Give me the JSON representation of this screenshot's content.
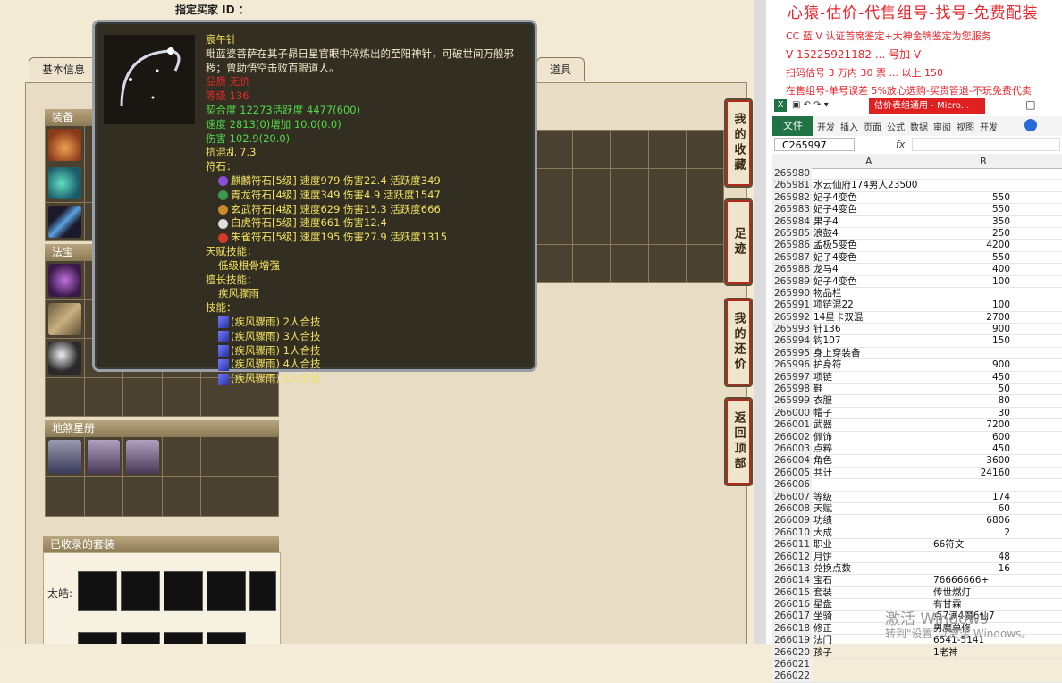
{
  "game": {
    "buyer_id_label": "指定买家 ID ：",
    "tabs": [
      {
        "label": "基本信息"
      },
      {
        "label": "道具"
      }
    ],
    "sections": {
      "equip": "装备",
      "fabao": "法宝",
      "disha": "地煞星册",
      "collected": "已收录的套装"
    },
    "suit_label": "太皓:",
    "side_buttons": [
      {
        "label": "我的收藏"
      },
      {
        "label": "足迹"
      },
      {
        "label": "我的还价"
      },
      {
        "label": "返回顶部"
      }
    ],
    "tooltip": {
      "name": "宸午针",
      "desc": "毗蓝婆菩萨在其子昴日星官眼中淬炼出的至阳神针，可破世间万般邪秽；曾助悟空击败百眼道人。",
      "req1": "品质  无价",
      "req2": "等级  136",
      "stat1": "契合度      12273活跃度    4477(600)",
      "stat2": "速度      2813(0)增加      10.0(0.0)",
      "stat3": "伤害    102.9(20.0)",
      "stat4": "抗混乱 7.3",
      "runes_label": "符石：",
      "runes": [
        {
          "text": "麒麟符石[5级] 速度979 伤害22.4 活跃度349",
          "color": "#8a4fd8"
        },
        {
          "text": "青龙符石[4级] 速度349 伤害4.9 活跃度1547",
          "color": "#3c9a4a"
        },
        {
          "text": "玄武符石[4级] 速度629 伤害15.3 活跃度666",
          "color": "#c88a2a"
        },
        {
          "text": "白虎符石[5级] 速度661 伤害12.4",
          "color": "#dddddd"
        },
        {
          "text": "朱雀符石[5级] 速度195 伤害27.9 活跃度1315",
          "color": "#d63a2a"
        }
      ],
      "talent_label": "天赋技能：",
      "talent": "低级根骨增强",
      "special_label": "擅长技能：",
      "special": "疾风骤雨",
      "skills_label": "技能：",
      "skills": [
        {
          "text": "(疾风骤雨) 2人合技"
        },
        {
          "text": "(疾风骤雨) 3人合技"
        },
        {
          "text": "(疾风骤雨) 1人合技"
        },
        {
          "text": "(疾风骤雨) 4人合技"
        },
        {
          "text": "(疾风骤雨) 5人合技"
        }
      ]
    }
  },
  "promo": {
    "title": "心猿-估价-代售组号-找号-免费配装",
    "line1": "CC 蓝 V 认证首席鉴定+大神金牌鉴定为您服务",
    "line2": "V 15225921182  ...  号加 V",
    "line3": "扫码估号 3 万内 30 票 ...  以上 150",
    "line4": "在售组号-单号误差 5%放心选购-买贵管退-不玩免费代卖"
  },
  "excel": {
    "window_title": "估价表组通用 - Micro...",
    "ribbon": [
      "文件",
      "开发",
      "插入",
      "页面",
      "公式",
      "数据",
      "审阅",
      "视图",
      "开发"
    ],
    "name_box": "C265997",
    "fx": "fx",
    "col_a": "A",
    "col_b": "B",
    "rows": [
      {
        "n": "265980",
        "a": "",
        "b": ""
      },
      {
        "n": "265981",
        "a": "水云仙府174男人23500",
        "b": ""
      },
      {
        "n": "265982",
        "a": "妃子4变色",
        "b": "550"
      },
      {
        "n": "265983",
        "a": "妃子4变色",
        "b": "550"
      },
      {
        "n": "265984",
        "a": "果子4",
        "b": "350"
      },
      {
        "n": "265985",
        "a": "浪鼓4",
        "b": "250"
      },
      {
        "n": "265986",
        "a": "孟极5变色",
        "b": "4200"
      },
      {
        "n": "265987",
        "a": "妃子4变色",
        "b": "550"
      },
      {
        "n": "265988",
        "a": "龙马4",
        "b": "400"
      },
      {
        "n": "265989",
        "a": "妃子4变色",
        "b": "100"
      },
      {
        "n": "265990",
        "a": "物品栏",
        "b": ""
      },
      {
        "n": "265991",
        "a": "项链混22",
        "b": "100"
      },
      {
        "n": "265992",
        "a": "14星卡双混",
        "b": "2700"
      },
      {
        "n": "265993",
        "a": "针136",
        "b": "900"
      },
      {
        "n": "265994",
        "a": "钩107",
        "b": "150"
      },
      {
        "n": "265995",
        "a": "身上穿装备",
        "b": ""
      },
      {
        "n": "265996",
        "a": "护身符",
        "b": "900"
      },
      {
        "n": "265997",
        "a": "项链",
        "b": "450"
      },
      {
        "n": "265998",
        "a": "鞋",
        "b": "50"
      },
      {
        "n": "265999",
        "a": "衣服",
        "b": "80"
      },
      {
        "n": "266000",
        "a": "帽子",
        "b": "30"
      },
      {
        "n": "266001",
        "a": "武器",
        "b": "7200"
      },
      {
        "n": "266002",
        "a": "佩饰",
        "b": "600"
      },
      {
        "n": "266003",
        "a": "点粹",
        "b": "450"
      },
      {
        "n": "266004",
        "a": "角色",
        "b": "3600"
      },
      {
        "n": "266005",
        "a": "共计",
        "b": "24160"
      },
      {
        "n": "266006",
        "a": "",
        "b": ""
      },
      {
        "n": "266007",
        "a": "等级",
        "b": "174"
      },
      {
        "n": "266008",
        "a": "天赋",
        "b": "60"
      },
      {
        "n": "266009",
        "a": "功绩",
        "b": "6806"
      },
      {
        "n": "266010",
        "a": "大成",
        "b": "2"
      },
      {
        "n": "266011",
        "a": "职业",
        "b": "66符文",
        "left": true
      },
      {
        "n": "266012",
        "a": "月饼",
        "b": "48"
      },
      {
        "n": "266013",
        "a": "兑换点数",
        "b": "16"
      },
      {
        "n": "266014",
        "a": "宝石",
        "b": "76666666+",
        "left": true
      },
      {
        "n": "266015",
        "a": "套装",
        "b": "传世燃灯",
        "left": true
      },
      {
        "n": "266016",
        "a": "星盘",
        "b": "有甘霖",
        "left": true
      },
      {
        "n": "266017",
        "a": "坐骑",
        "b": "点7满4魔6仙7",
        "left": true
      },
      {
        "n": "266018",
        "a": "修正",
        "b": "男魔单修",
        "left": true
      },
      {
        "n": "266019",
        "a": "法门",
        "b": "6541-5141",
        "left": true
      },
      {
        "n": "266020",
        "a": "孩子",
        "b": "1老神",
        "left": true
      },
      {
        "n": "266021",
        "a": "",
        "b": ""
      },
      {
        "n": "266022",
        "a": "",
        "b": ""
      }
    ]
  },
  "watermark": {
    "line1": "激活 Windows",
    "line2": "转到\"设置\"以激活 Windows。"
  },
  "colors": {
    "promo_red": "#e8252b",
    "tooltip_bg": "#322e22",
    "excel_green": "#217346"
  }
}
